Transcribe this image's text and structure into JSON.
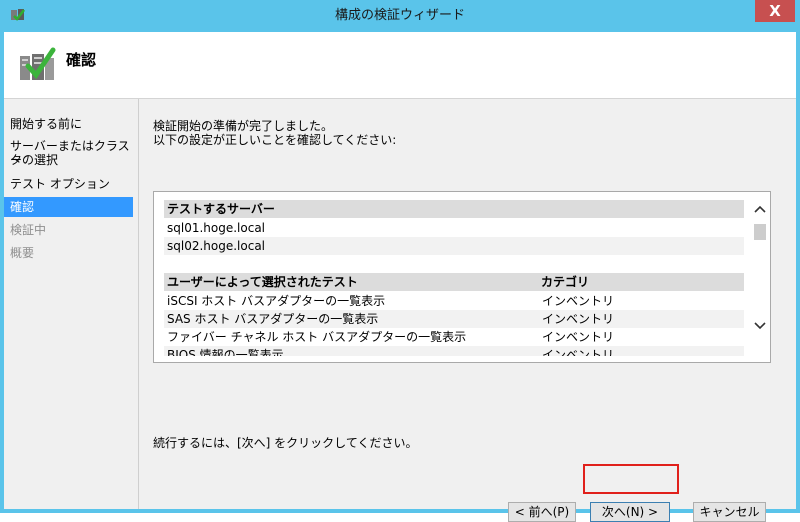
{
  "window": {
    "title": "構成の検証ウィザード",
    "close_glyph": "X",
    "app_icon": "cluster-validation-icon"
  },
  "header": {
    "title": "確認",
    "icon": "server-check-icon"
  },
  "nav": {
    "items": [
      {
        "label": "開始する前に",
        "state": "normal"
      },
      {
        "label": "サーバーまたはクラスタ",
        "state": "normal"
      },
      {
        "label": "ーの選択",
        "state": "normal"
      },
      {
        "label": "テスト オプション",
        "state": "normal"
      },
      {
        "label": "確認",
        "state": "selected"
      },
      {
        "label": "検証中",
        "state": "disabled"
      },
      {
        "label": "概要",
        "state": "disabled"
      }
    ]
  },
  "main": {
    "intro_line1": "検証開始の準備が完了しました。",
    "intro_line2": "以下の設定が正しいことを確認してください:",
    "servers_header": "テストするサーバー",
    "servers": [
      "sql01.hoge.local",
      "sql02.hoge.local"
    ],
    "tests_header": "ユーザーによって選択されたテスト",
    "category_header": "カテゴリ",
    "tests": [
      {
        "name": "iSCSI ホスト バスアダプターの一覧表示",
        "category": "インベントリ"
      },
      {
        "name": "SAS ホスト バスアダプターの一覧表示",
        "category": "インベントリ"
      },
      {
        "name": "ファイバー チャネル ホスト バスアダプターの一覧表示",
        "category": "インベントリ"
      },
      {
        "name": "BIOS 情報の一覧表示",
        "category": "インベントリ"
      }
    ],
    "footer": "続行するには、[次へ] をクリックしてください。"
  },
  "buttons": {
    "back": "< 前へ(P)",
    "next": "次へ(N) >",
    "cancel": "キャンセル"
  },
  "colors": {
    "titlebar": "#5ac4ea",
    "selected_nav": "#3399ff",
    "highlight": "#e0201b",
    "close_button": "#c75050"
  }
}
